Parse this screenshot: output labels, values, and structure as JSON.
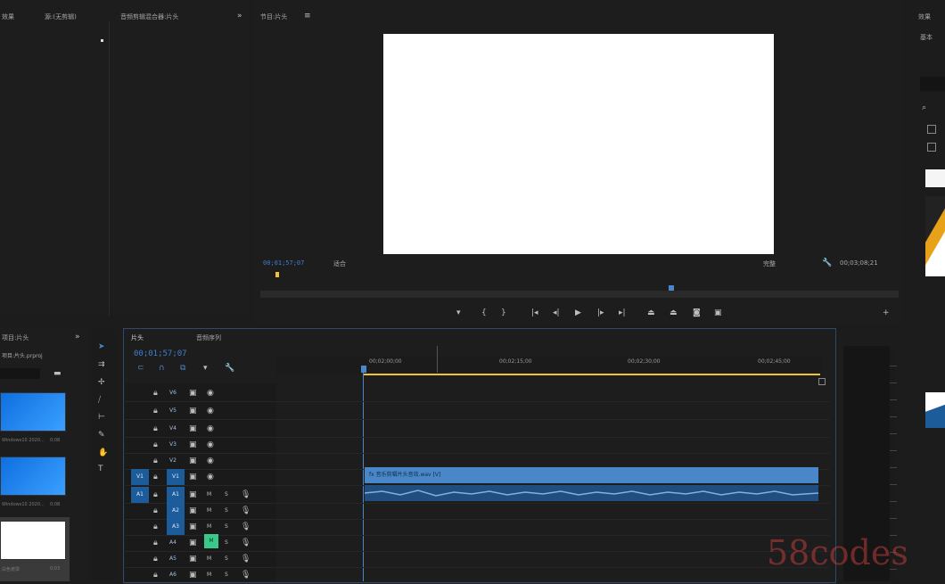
{
  "top_left_panel": {
    "title": "效果",
    "tab2": "源:(无剪辑)",
    "tab3": "音频剪辑混合器:片头"
  },
  "program_monitor": {
    "title": "节目:片头",
    "timecode": "00;01;57;07",
    "fit_label": "适合",
    "quality_label": "完整",
    "duration": "00;03;08;21",
    "menu_icon": "double-chevron-icon"
  },
  "right_panel": {
    "title": "效果",
    "label": "基本",
    "search_icon": "search-icon"
  },
  "project_panel": {
    "title": "项目:片头",
    "subtitle": "项目:片头.prproj",
    "items": [
      {
        "name": "Windows10 2020...",
        "dur": "0;08"
      },
      {
        "name": "Windows10 2020...",
        "dur": "0;08"
      },
      {
        "name": "白色遮罩",
        "dur": "0;03"
      }
    ]
  },
  "timeline": {
    "tab_active": "片头",
    "tab_2": "音频序列",
    "timecode": "00;01;57;07",
    "ruler": [
      "00;02;00;00",
      "00;02;15;00",
      "00;02;30;00",
      "00;02;45;00"
    ],
    "video_tracks": [
      "V6",
      "V5",
      "V4",
      "V3",
      "V2",
      "V1"
    ],
    "audio_tracks": [
      "A1",
      "A2",
      "A3",
      "A4",
      "A5",
      "A6"
    ],
    "left_labels": {
      "v": "V1",
      "a": "A1"
    },
    "m_label": "M",
    "s_label": "S",
    "clip_label": "fx 音乐剪辑片头音效.wav [V]",
    "colors": {
      "clip_video": "#4a87c8",
      "clip_audio": "#1f4e7f",
      "accent": "#3f7fd0",
      "playhead": "#f1c232"
    }
  },
  "watermark": "58codes"
}
